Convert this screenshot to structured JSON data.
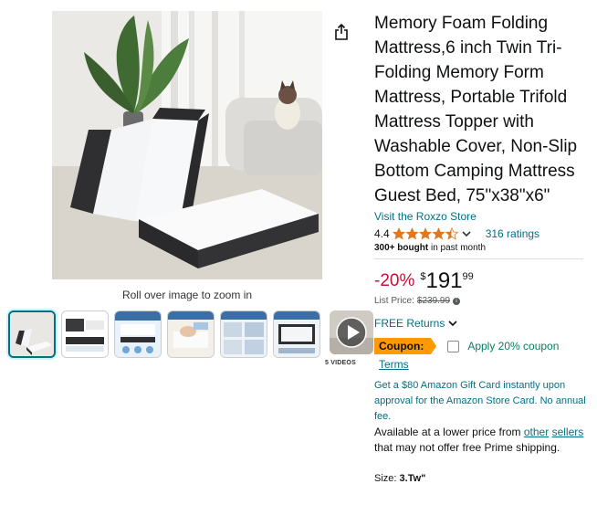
{
  "product": {
    "title": "Memory Foam Folding Mattress,6 inch Twin Tri-Folding Memory Form Mattress, Portable Trifold Mattress Topper with Washable Cover, Non-Slip Bottom Camping Mattress Guest Bed, 75\"x38\"x6\"",
    "store_link": "Visit the Roxzo Store",
    "rating": "4.4",
    "stars": 4.4,
    "ratings_count": "316 ratings",
    "bought_strong": "300+ bought",
    "bought_rest": " in past month"
  },
  "gallery": {
    "zoom_hint": "Roll over image to zoom in",
    "video_label": "5 VIDEOS",
    "thumbnails": [
      "mattress-folded",
      "mattress-dimensions",
      "product-features",
      "hand-press-foam",
      "usage-scenes",
      "washable-cover"
    ]
  },
  "price": {
    "discount": "-20%",
    "symbol": "$",
    "whole": "191",
    "fraction": "99",
    "list_label": "List Price:",
    "list_value": "$239.99"
  },
  "returns": {
    "label": "FREE Returns"
  },
  "coupon": {
    "badge": "Coupon:",
    "text": "Apply 20% coupon",
    "terms": "Terms",
    "checked": false
  },
  "promo": {
    "gift_card": "Get a $80 Amazon Gift Card instantly upon approval for the Amazon Store Card. No annual fee.",
    "lower_prefix": "Available at a lower price from ",
    "lower_link_1": "other",
    "lower_link_2": "sellers",
    "lower_suffix": " that may not offer free Prime shipping."
  },
  "size": {
    "label": "Size: ",
    "value": "3.Tw\""
  },
  "colors": {
    "link": "#007185",
    "deal_red": "#cc0c39",
    "star": "#de7921",
    "coupon": "#ff9900",
    "coupon_text": "#067d62"
  }
}
